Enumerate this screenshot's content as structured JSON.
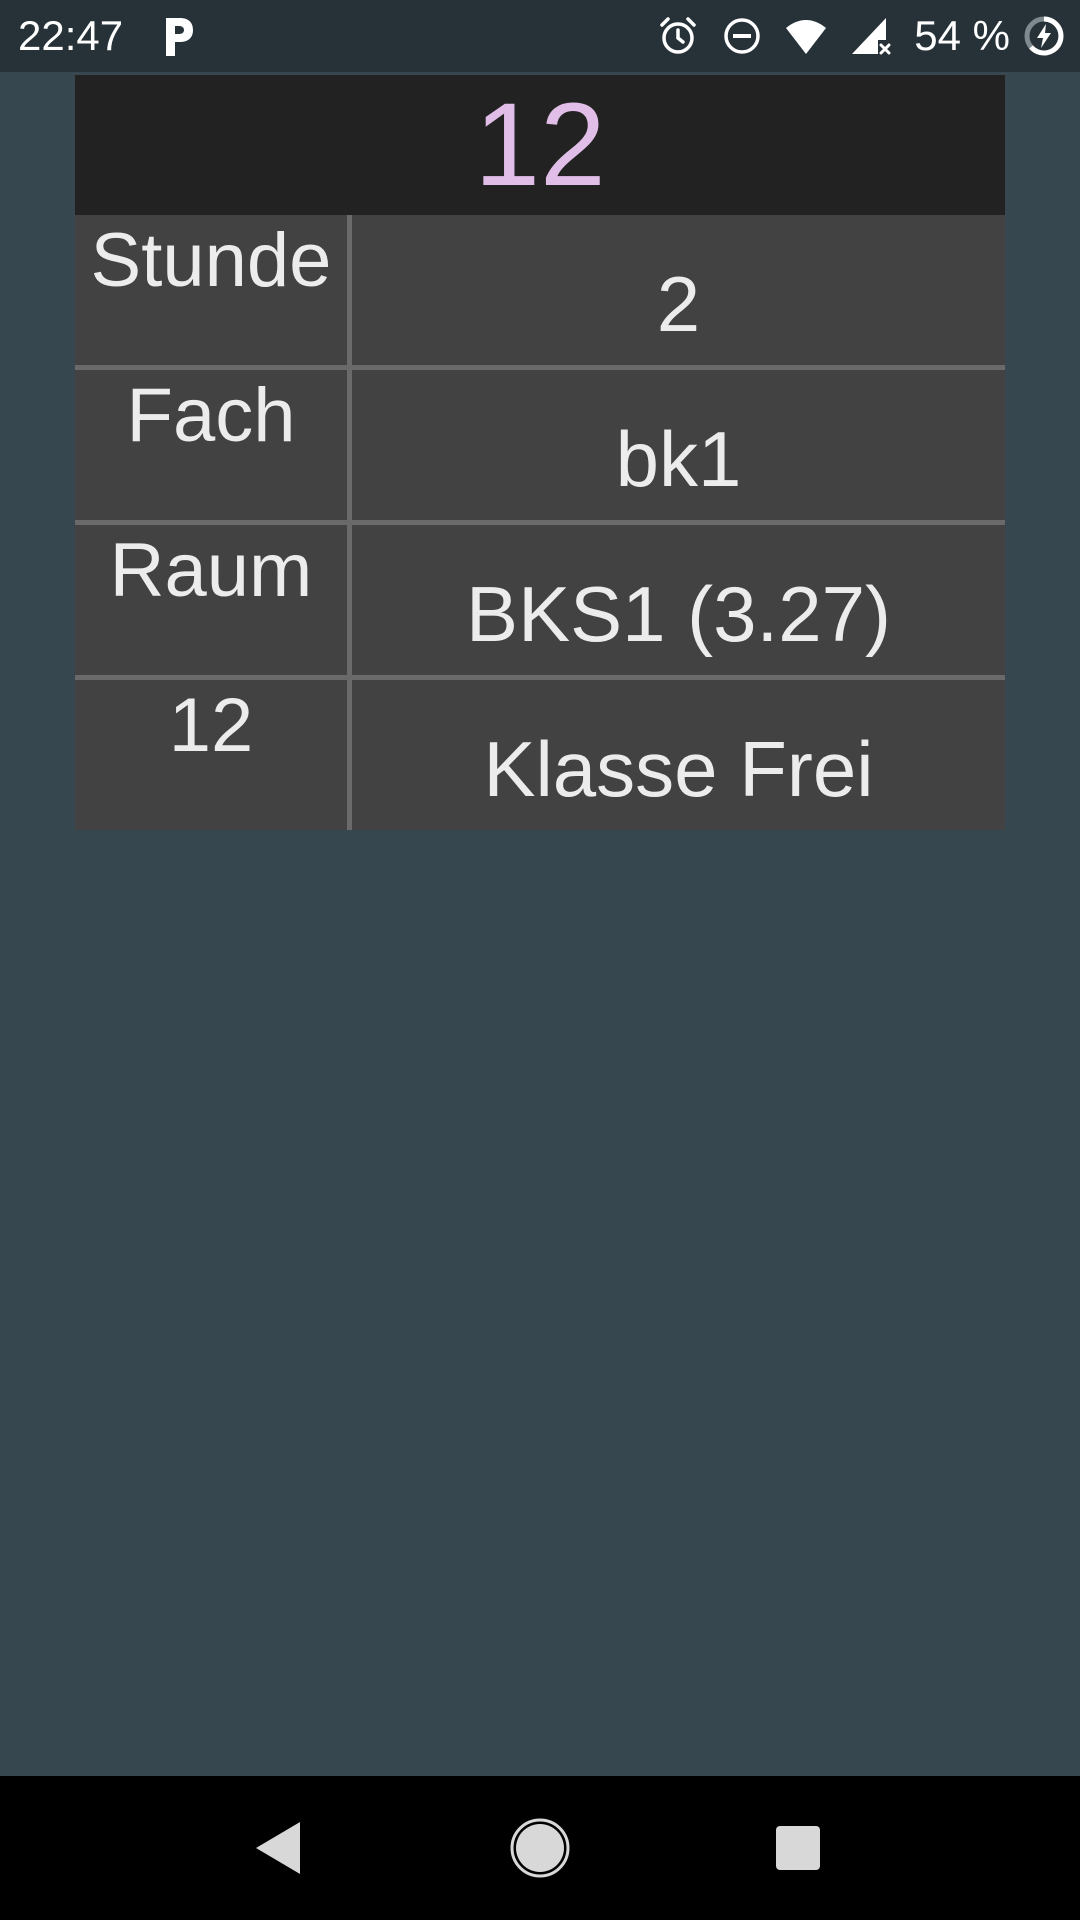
{
  "status_bar": {
    "time": "22:47",
    "battery_percent": "54 %",
    "app_icon": "parking-p-icon",
    "icons": [
      "alarm-icon",
      "do-not-disturb-icon",
      "wifi-icon",
      "cellular-no-data-icon",
      "battery-charging-icon"
    ]
  },
  "card": {
    "title": "12",
    "title_color": "#e1bee7",
    "rows": [
      {
        "label": "Stunde",
        "value": "2"
      },
      {
        "label": "Fach",
        "value": "bk1"
      },
      {
        "label": "Raum",
        "value": "BKS1 (3.27)"
      },
      {
        "label": "12",
        "value": "Klasse Frei"
      }
    ]
  },
  "navigation": {
    "buttons": [
      "back-icon",
      "home-icon",
      "recents-icon"
    ]
  },
  "colors": {
    "background": "#37474f",
    "status_bar": "#263238",
    "card_header": "#222222",
    "card_body": "#424242",
    "divider": "#6a6a6a"
  }
}
